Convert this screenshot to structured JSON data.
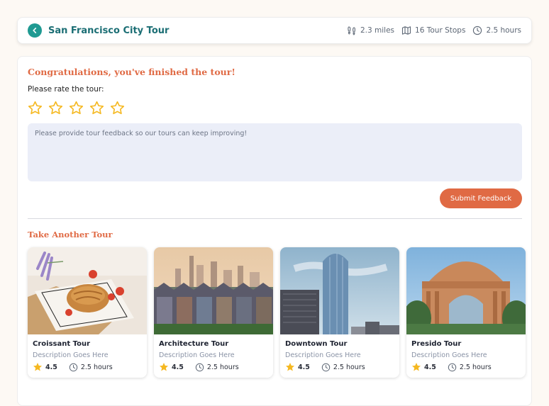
{
  "header": {
    "title": "San Francisco City Tour",
    "distance": "2.3 miles",
    "stops": "16 Tour Stops",
    "duration": "2.5 hours"
  },
  "feedback": {
    "congrats": "Congratulations, you've finished the tour!",
    "rate_prompt": "Please rate the tour:",
    "star_count": 5,
    "placeholder": "Please provide tour feedback so our tours can keep improving!",
    "submit_label": "Submit Feedback"
  },
  "more_tours": {
    "heading": "Take Another Tour",
    "tours": [
      {
        "name": "Croissant Tour",
        "description": "Description Goes Here",
        "rating": "4.5",
        "duration": "2.5 hours"
      },
      {
        "name": "Architecture Tour",
        "description": "Description Goes Here",
        "rating": "4.5",
        "duration": "2.5 hours"
      },
      {
        "name": "Downtown Tour",
        "description": "Description Goes Here",
        "rating": "4.5",
        "duration": "2.5 hours"
      },
      {
        "name": "Presido Tour",
        "description": "Description Goes Here",
        "rating": "4.5",
        "duration": "2.5 hours"
      }
    ]
  },
  "colors": {
    "accent_teal": "#1f9a92",
    "accent_orange": "#e06a44",
    "star_gold": "#f5b820"
  }
}
